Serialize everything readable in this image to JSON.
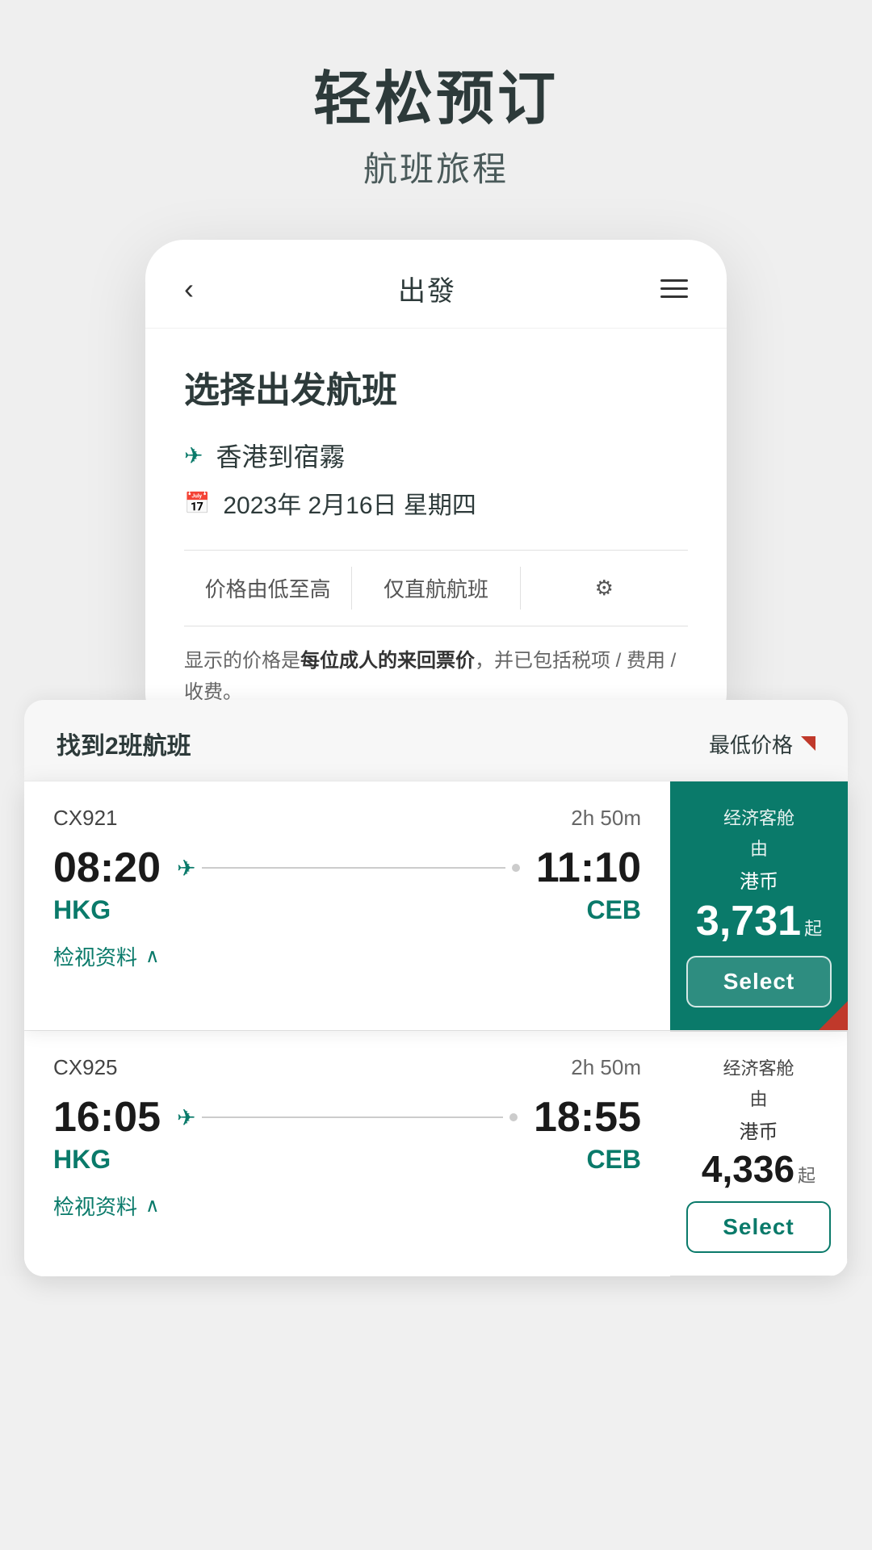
{
  "hero": {
    "title": "轻松预订",
    "subtitle": "航班旅程"
  },
  "app": {
    "header_title": "出發",
    "back_label": "‹",
    "select_flight_title": "选择出发航班",
    "route": "香港到宿霧",
    "date": "2023年 2月16日 星期四",
    "filter1": "价格由低至高",
    "filter2": "仅直航航班",
    "price_notice": "显示的价格是每位成人的来回票价，并已包括税项 / 费用 / 收费。",
    "price_notice_bold": "每位成人的来回票价"
  },
  "results": {
    "found_label": "找到2班航班",
    "lowest_price_label": "最低价格",
    "flights": [
      {
        "number": "CX921",
        "duration": "2h 50m",
        "depart_time": "08:20",
        "arrive_time": "11:10",
        "origin": "HKG",
        "destination": "CEB",
        "cabin": "经济客舱",
        "by": "由",
        "currency": "港币",
        "price": "3,731",
        "suffix": "起",
        "select_label": "Select",
        "view_details": "检视资料"
      },
      {
        "number": "CX925",
        "duration": "2h 50m",
        "depart_time": "16:05",
        "arrive_time": "18:55",
        "origin": "HKG",
        "destination": "CEB",
        "cabin": "经济客舱",
        "by": "由",
        "currency": "港币",
        "price": "4,336",
        "suffix": "起",
        "select_label": "Select",
        "view_details": "检视资料"
      }
    ]
  },
  "colors": {
    "teal": "#0a7a6a",
    "red": "#c0392b",
    "dark": "#2d3a3a"
  }
}
